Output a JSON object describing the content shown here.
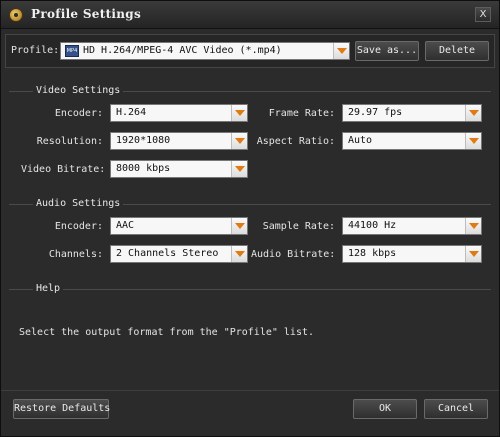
{
  "window": {
    "title": "Profile Settings",
    "close_glyph": "X"
  },
  "profile": {
    "label": "Profile:",
    "badge": "MP4",
    "value": "HD H.264/MPEG-4 AVC Video (*.mp4)",
    "save_as_label": "Save as...",
    "delete_label": "Delete"
  },
  "video": {
    "title": "Video Settings",
    "encoder": {
      "label": "Encoder:",
      "value": "H.264"
    },
    "frame_rate": {
      "label": "Frame Rate:",
      "value": "29.97 fps"
    },
    "resolution": {
      "label": "Resolution:",
      "value": "1920*1080"
    },
    "aspect_ratio": {
      "label": "Aspect Ratio:",
      "value": "Auto"
    },
    "bitrate": {
      "label": "Video Bitrate:",
      "value": "8000 kbps"
    }
  },
  "audio": {
    "title": "Audio Settings",
    "encoder": {
      "label": "Encoder:",
      "value": "AAC"
    },
    "sample_rate": {
      "label": "Sample Rate:",
      "value": "44100 Hz"
    },
    "channels": {
      "label": "Channels:",
      "value": "2 Channels Stereo"
    },
    "bitrate": {
      "label": "Audio Bitrate:",
      "value": "128 kbps"
    }
  },
  "help": {
    "title": "Help",
    "text": "Select the output format from the \"Profile\" list."
  },
  "footer": {
    "restore_label": "Restore Defaults",
    "ok_label": "OK",
    "cancel_label": "Cancel"
  },
  "colors": {
    "window_bg": "#2b2b2b",
    "titlebar_bg": "#303030",
    "dropdown_arrow": "#e07a12",
    "field_bg": "#f7f7f7"
  }
}
